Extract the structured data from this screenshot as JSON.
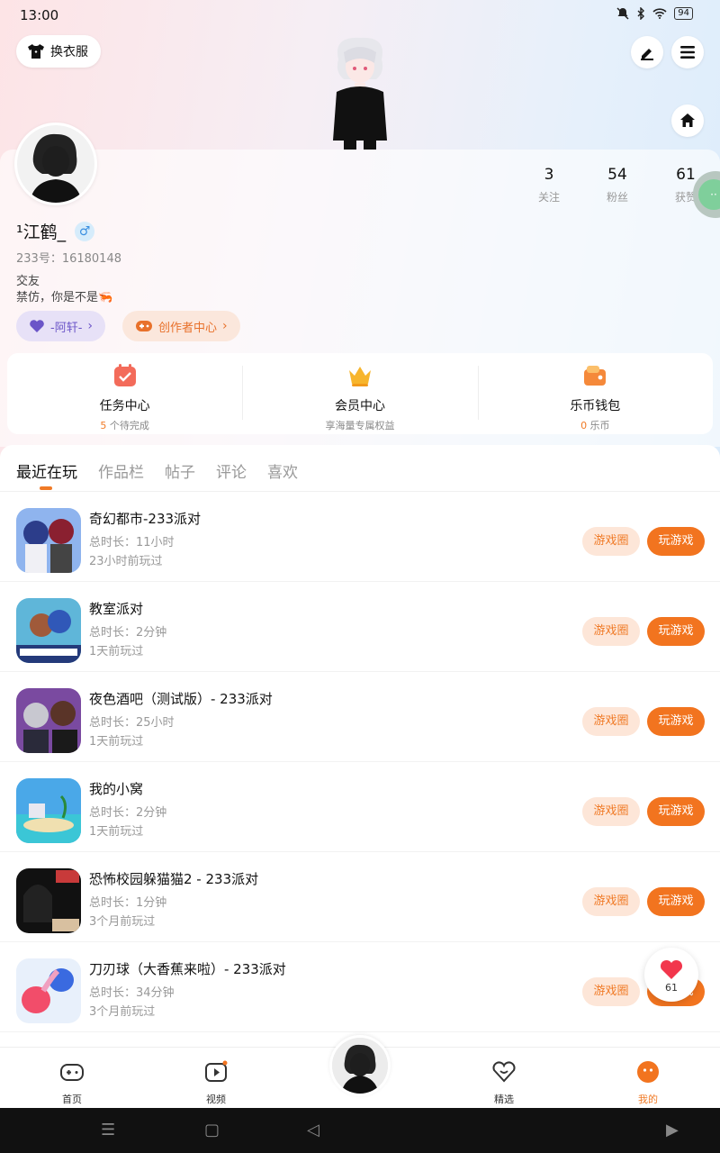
{
  "status": {
    "time": "13:00",
    "battery": "94"
  },
  "header": {
    "outfit_label": "换衣服"
  },
  "profile": {
    "username": "¹江鹤_",
    "uid": "233号：16180148",
    "bio_line1": "交友",
    "bio_line2": "禁仿，你是不是🦐",
    "gender_symbol": "♂",
    "stats": [
      {
        "value": "3",
        "label": "关注"
      },
      {
        "value": "54",
        "label": "粉丝"
      },
      {
        "value": "61",
        "label": "获赞"
      }
    ],
    "tag_friend": "-阿轩-",
    "tag_creator": "创作者中心"
  },
  "centers": [
    {
      "title": "任务中心",
      "highlight": "5",
      "sub": " 个待完成"
    },
    {
      "title": "会员中心",
      "highlight": "",
      "sub": "享海量专属权益"
    },
    {
      "title": "乐币钱包",
      "highlight": "0",
      "sub": " 乐币"
    }
  ],
  "tabs": [
    "最近在玩",
    "作品栏",
    "帖子",
    "评论",
    "喜欢"
  ],
  "games": [
    {
      "title": "奇幻都市-233派对",
      "duration": "总时长：11小时",
      "last": "23小时前玩过"
    },
    {
      "title": "教室派对",
      "duration": "总时长：2分钟",
      "last": "1天前玩过"
    },
    {
      "title": "夜色酒吧（测试版）- 233派对",
      "duration": "总时长：25小时",
      "last": "1天前玩过"
    },
    {
      "title": "我的小窝",
      "duration": "总时长：2分钟",
      "last": "1天前玩过"
    },
    {
      "title": "恐怖校园躲猫猫2 - 233派对",
      "duration": "总时长：1分钟",
      "last": "3个月前玩过"
    },
    {
      "title": "刀刃球（大香蕉来啦）- 233派对",
      "duration": "总时长：34分钟",
      "last": "3个月前玩过"
    }
  ],
  "game_buttons": {
    "circle": "游戏圈",
    "play": "玩游戏"
  },
  "like_count": "61",
  "nav": [
    "首页",
    "视频",
    "精选",
    "我的"
  ],
  "colors": {
    "accent": "#f2741f",
    "friend_tag": "#6b55c8"
  }
}
